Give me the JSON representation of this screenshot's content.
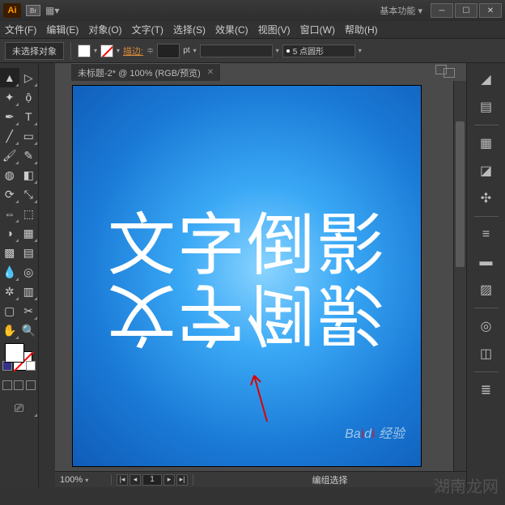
{
  "titlebar": {
    "logo": "Ai",
    "badge": "Br",
    "workspace": "基本功能"
  },
  "menu": [
    "文件(F)",
    "编辑(E)",
    "对象(O)",
    "文字(T)",
    "选择(S)",
    "效果(C)",
    "视图(V)",
    "窗口(W)",
    "帮助(H)"
  ],
  "options": {
    "noselection": "未选择对象",
    "stroke_label": "描边:",
    "stroke_pt": "pt",
    "dash_label": "5 点圆形"
  },
  "tab": {
    "title": "未标题-2* @ 100% (RGB/预览)"
  },
  "canvas": {
    "text": "文字倒影"
  },
  "status": {
    "zoom": "100%",
    "page": "1",
    "mode": "编组选择"
  },
  "watermark": {
    "baidu": "经验",
    "site": "湖南龙网"
  }
}
